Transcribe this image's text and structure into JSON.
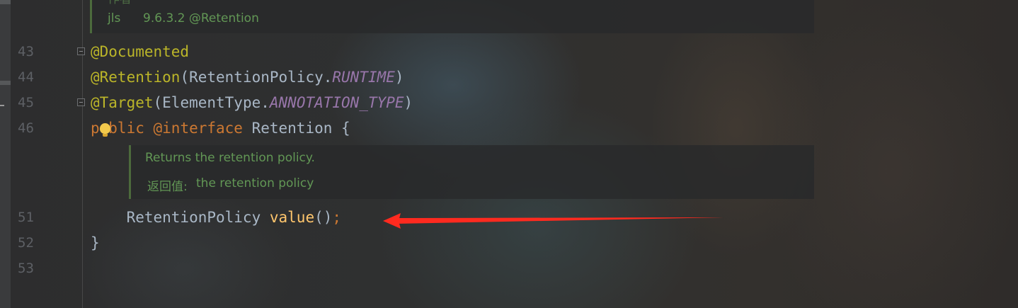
{
  "editor": {
    "top_doc": {
      "partial_text": "作者",
      "tag": "jls",
      "value": "9.6.3.2 @Retention"
    },
    "lines": [
      {
        "number": "43",
        "tokens": [
          {
            "t": "@Documented",
            "c": "ann"
          }
        ]
      },
      {
        "number": "44",
        "tokens": [
          {
            "t": "@Retention",
            "c": "ann"
          },
          {
            "t": "(RetentionPolicy.",
            "c": "cls"
          },
          {
            "t": "RUNTIME",
            "c": "ital"
          },
          {
            "t": ")",
            "c": "cls"
          }
        ]
      },
      {
        "number": "45",
        "tokens": [
          {
            "t": "@Target",
            "c": "ann"
          },
          {
            "t": "(ElementType.",
            "c": "cls"
          },
          {
            "t": "ANNOTATION_TYPE",
            "c": "ital"
          },
          {
            "t": ")",
            "c": "cls"
          }
        ]
      },
      {
        "number": "46",
        "tokens": [
          {
            "t": "public",
            "c": "kw"
          },
          {
            "t": " ",
            "c": "cls"
          },
          {
            "t": "@interface",
            "c": "kw"
          },
          {
            "t": " Retention {",
            "c": "cls"
          }
        ]
      },
      {
        "number": "51",
        "tokens": [
          {
            "t": "    RetentionPolicy ",
            "c": "cls"
          },
          {
            "t": "value",
            "c": "meth"
          },
          {
            "t": "()",
            "c": "cls"
          },
          {
            "t": ";",
            "c": "semi"
          }
        ]
      },
      {
        "number": "52",
        "tokens": [
          {
            "t": "}",
            "c": "cls"
          }
        ]
      },
      {
        "number": "53",
        "tokens": []
      }
    ],
    "method_doc": {
      "description": "Returns the retention policy.",
      "returns_label": "返回值:",
      "returns_text": "the retention policy"
    },
    "annotation_color": "#bbb529",
    "keyword_color": "#cc7832",
    "method_color": "#ffc66d",
    "arrow_color": "#ff2a1f"
  }
}
